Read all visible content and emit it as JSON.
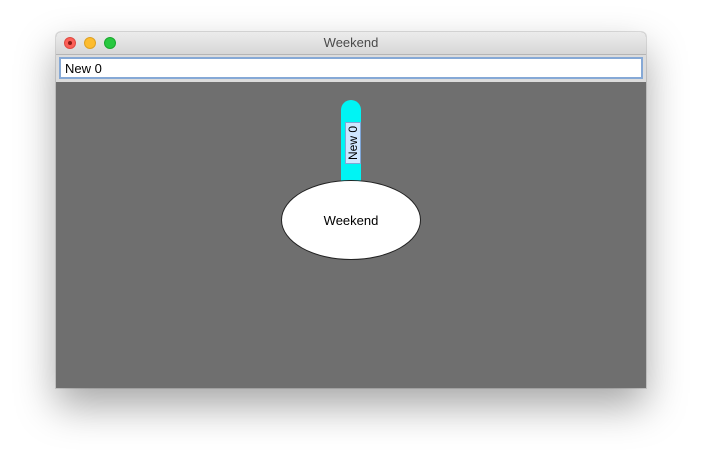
{
  "window": {
    "title": "Weekend"
  },
  "toolbar": {
    "name_value": "New 0"
  },
  "canvas": {
    "node_label": "Weekend",
    "tag_label": "New 0",
    "tag_color": "#00f4f4",
    "background_color": "#6f6f6f"
  }
}
